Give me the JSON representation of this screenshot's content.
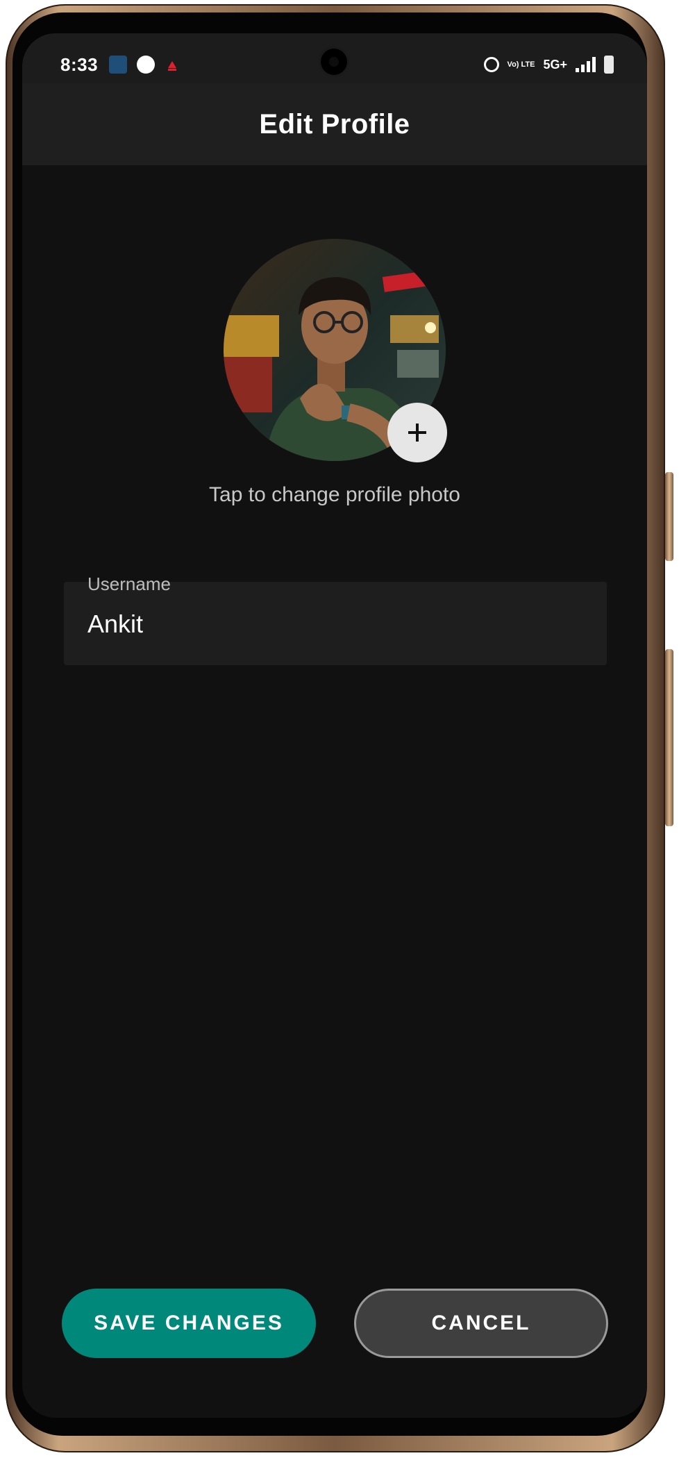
{
  "status_bar": {
    "time": "8:33",
    "network": "5G+",
    "volte": "Vo) LTE",
    "icons": [
      "app-icon",
      "speed-icon",
      "notification-icon",
      "alarm-icon",
      "volte-icon",
      "signal-icon",
      "battery-icon"
    ]
  },
  "app_bar": {
    "title": "Edit Profile"
  },
  "profile": {
    "photo_hint": "Tap to change profile photo",
    "add_photo_icon": "plus-icon"
  },
  "username": {
    "label": "Username",
    "value": "Ankit"
  },
  "actions": {
    "save_label": "SAVE CHANGES",
    "cancel_label": "CANCEL"
  },
  "colors": {
    "background": "#111111",
    "app_bar": "#1f1f1f",
    "accent": "#00897b",
    "secondary_button": "#3f3f3f"
  }
}
